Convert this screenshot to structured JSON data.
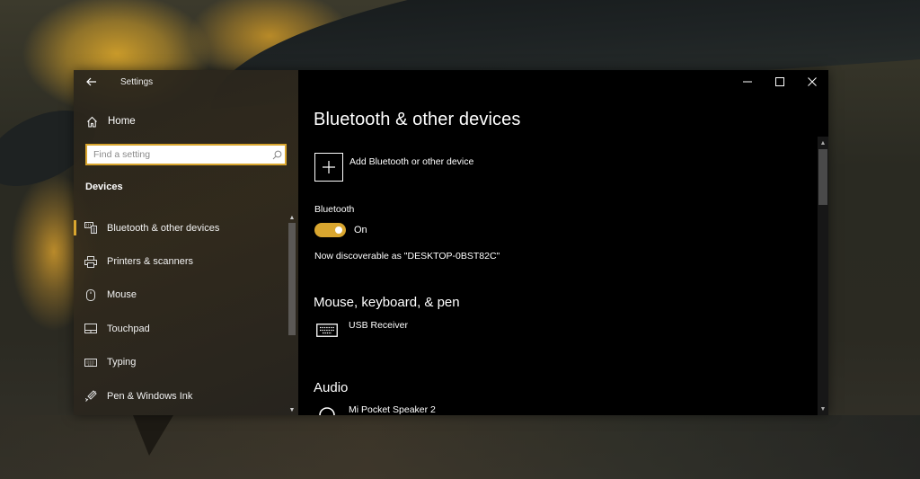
{
  "window": {
    "app_title": "Settings",
    "caption_buttons": [
      "minimize",
      "maximize",
      "close"
    ]
  },
  "nav": {
    "home_label": "Home",
    "search_placeholder": "Find a setting",
    "search_value": "",
    "section_label": "Devices",
    "items": [
      {
        "label": "Bluetooth & other devices",
        "icon": "bluetooth-devices-icon",
        "active": true
      },
      {
        "label": "Printers & scanners",
        "icon": "printer-icon",
        "active": false
      },
      {
        "label": "Mouse",
        "icon": "mouse-icon",
        "active": false
      },
      {
        "label": "Touchpad",
        "icon": "touchpad-icon",
        "active": false
      },
      {
        "label": "Typing",
        "icon": "keyboard-icon",
        "active": false
      },
      {
        "label": "Pen & Windows Ink",
        "icon": "pen-icon",
        "active": false
      }
    ]
  },
  "main": {
    "title": "Bluetooth & other devices",
    "add_device_label": "Add Bluetooth or other device",
    "bluetooth_label": "Bluetooth",
    "bluetooth_state": "On",
    "bluetooth_on": true,
    "discoverable_text": "Now discoverable as \"DESKTOP-0BST82C\"",
    "sections": [
      {
        "heading": "Mouse, keyboard, & pen",
        "devices": [
          {
            "name": "USB Receiver",
            "icon": "keyboard-icon"
          }
        ]
      },
      {
        "heading": "Audio",
        "devices": [
          {
            "name": "Mi Pocket Speaker 2",
            "icon": "headphones-icon"
          }
        ]
      }
    ]
  },
  "colors": {
    "accent": "#d9a62f",
    "content_bg": "#000000",
    "text": "#ffffff"
  }
}
